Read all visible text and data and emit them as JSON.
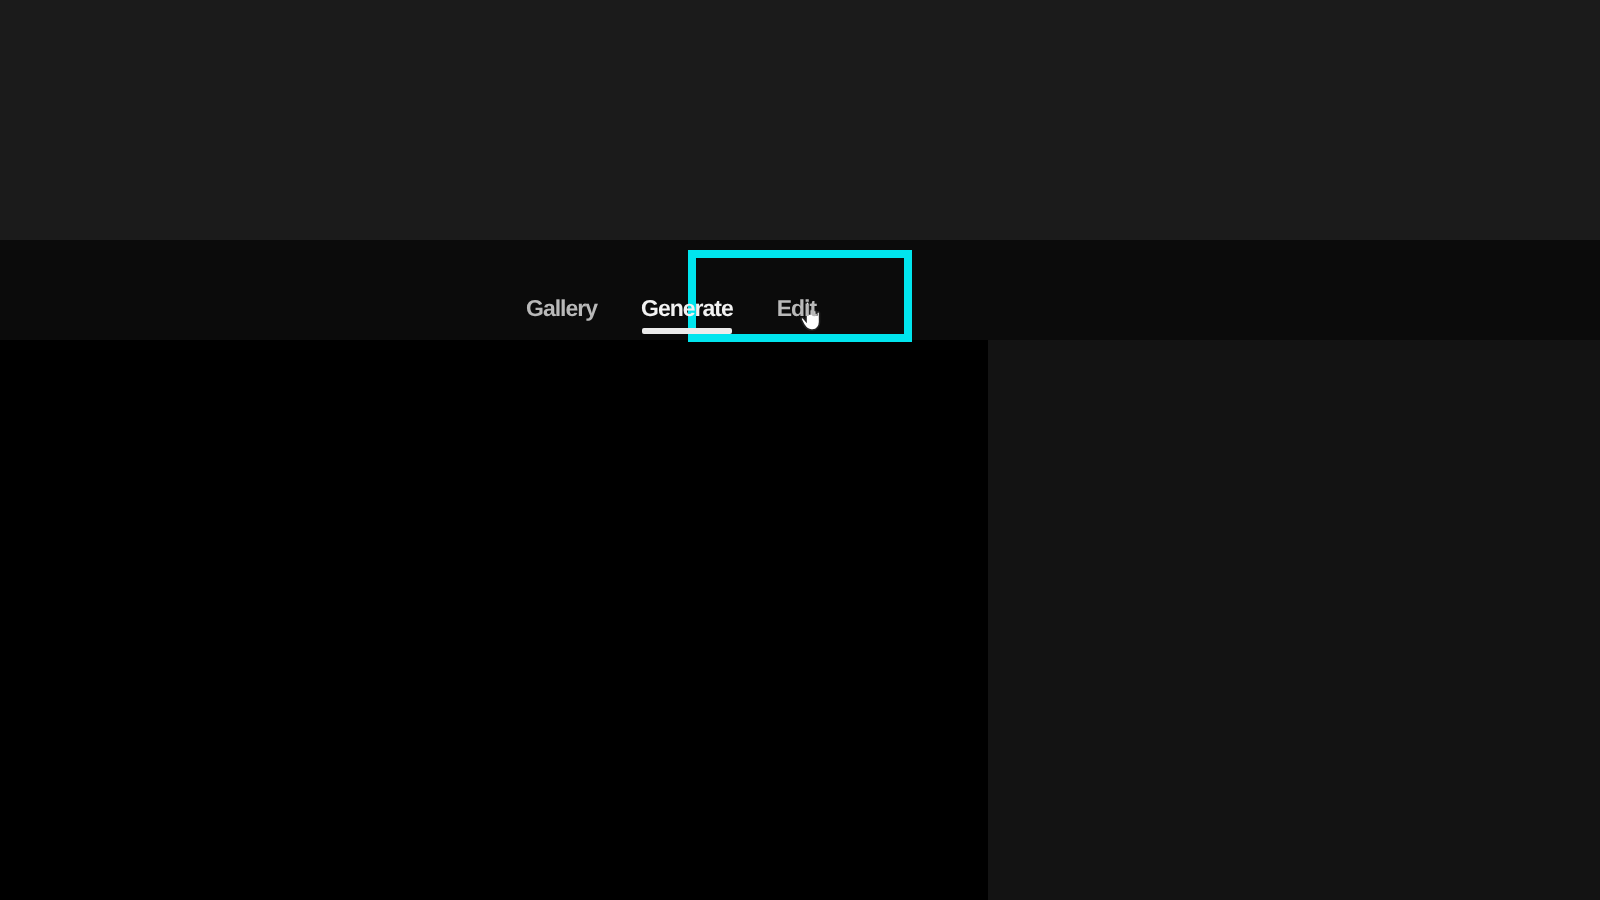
{
  "tabs": [
    {
      "label": "Gallery",
      "selected": false,
      "highlighted": false,
      "hovered": false
    },
    {
      "label": "Generate",
      "selected": true,
      "highlighted": false,
      "hovered": false
    },
    {
      "label": "Edit",
      "selected": false,
      "highlighted": true,
      "hovered": true
    }
  ]
}
